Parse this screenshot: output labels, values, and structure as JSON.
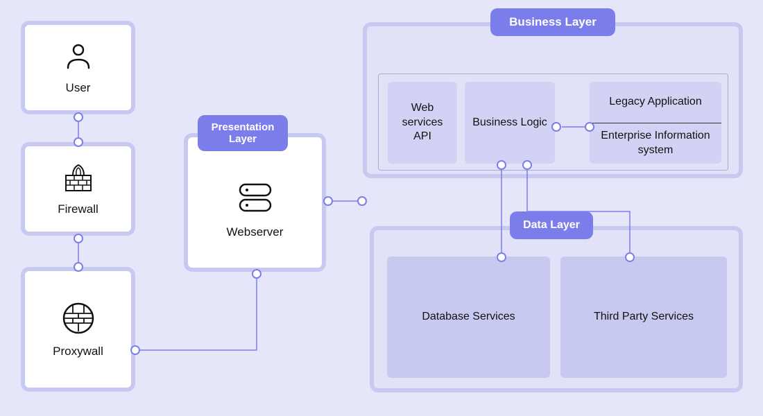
{
  "nodes": {
    "user": {
      "label": "User"
    },
    "firewall": {
      "label": "Firewall"
    },
    "proxywall": {
      "label": "Proxywall"
    },
    "webserver": {
      "label": "Webserver"
    }
  },
  "layers": {
    "presentation": {
      "title": "Presentation Layer"
    },
    "business": {
      "title": "Business Layer"
    },
    "data": {
      "title": "Data Layer"
    }
  },
  "business_boxes": {
    "web_api": {
      "label": "Web services API"
    },
    "biz_logic": {
      "label": "Business Logic"
    },
    "legacy": {
      "label": "Legacy Application"
    },
    "eis": {
      "label": "Enterprise Information system"
    }
  },
  "data_boxes": {
    "db": {
      "label": "Database Services"
    },
    "third": {
      "label": "Third Party Services"
    }
  },
  "icons": {
    "user": "user-icon",
    "firewall": "firewall-icon",
    "proxywall": "proxywall-icon",
    "webserver": "server-icon"
  },
  "colors": {
    "bg": "#e6e6fa",
    "border": "#c7c9f0",
    "badge": "#7b7eea",
    "inner": "#d2d3f4"
  },
  "connections": [
    [
      "user",
      "firewall"
    ],
    [
      "firewall",
      "proxywall"
    ],
    [
      "proxywall",
      "webserver"
    ],
    [
      "webserver",
      "business_layer"
    ],
    [
      "biz_logic",
      "legacy_eis"
    ],
    [
      "biz_logic",
      "db"
    ],
    [
      "biz_logic",
      "third"
    ]
  ]
}
